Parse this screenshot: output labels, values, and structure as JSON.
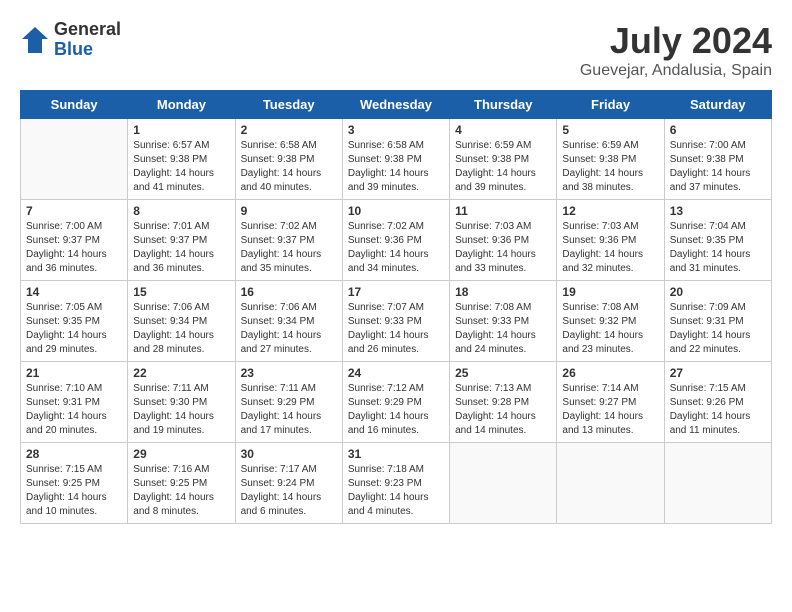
{
  "header": {
    "logo_general": "General",
    "logo_blue": "Blue",
    "month_title": "July 2024",
    "location": "Guevejar, Andalusia, Spain"
  },
  "days_of_week": [
    "Sunday",
    "Monday",
    "Tuesday",
    "Wednesday",
    "Thursday",
    "Friday",
    "Saturday"
  ],
  "weeks": [
    [
      {
        "day": "",
        "info": ""
      },
      {
        "day": "1",
        "info": "Sunrise: 6:57 AM\nSunset: 9:38 PM\nDaylight: 14 hours\nand 41 minutes."
      },
      {
        "day": "2",
        "info": "Sunrise: 6:58 AM\nSunset: 9:38 PM\nDaylight: 14 hours\nand 40 minutes."
      },
      {
        "day": "3",
        "info": "Sunrise: 6:58 AM\nSunset: 9:38 PM\nDaylight: 14 hours\nand 39 minutes."
      },
      {
        "day": "4",
        "info": "Sunrise: 6:59 AM\nSunset: 9:38 PM\nDaylight: 14 hours\nand 39 minutes."
      },
      {
        "day": "5",
        "info": "Sunrise: 6:59 AM\nSunset: 9:38 PM\nDaylight: 14 hours\nand 38 minutes."
      },
      {
        "day": "6",
        "info": "Sunrise: 7:00 AM\nSunset: 9:38 PM\nDaylight: 14 hours\nand 37 minutes."
      }
    ],
    [
      {
        "day": "7",
        "info": "Sunrise: 7:00 AM\nSunset: 9:37 PM\nDaylight: 14 hours\nand 36 minutes."
      },
      {
        "day": "8",
        "info": "Sunrise: 7:01 AM\nSunset: 9:37 PM\nDaylight: 14 hours\nand 36 minutes."
      },
      {
        "day": "9",
        "info": "Sunrise: 7:02 AM\nSunset: 9:37 PM\nDaylight: 14 hours\nand 35 minutes."
      },
      {
        "day": "10",
        "info": "Sunrise: 7:02 AM\nSunset: 9:36 PM\nDaylight: 14 hours\nand 34 minutes."
      },
      {
        "day": "11",
        "info": "Sunrise: 7:03 AM\nSunset: 9:36 PM\nDaylight: 14 hours\nand 33 minutes."
      },
      {
        "day": "12",
        "info": "Sunrise: 7:03 AM\nSunset: 9:36 PM\nDaylight: 14 hours\nand 32 minutes."
      },
      {
        "day": "13",
        "info": "Sunrise: 7:04 AM\nSunset: 9:35 PM\nDaylight: 14 hours\nand 31 minutes."
      }
    ],
    [
      {
        "day": "14",
        "info": "Sunrise: 7:05 AM\nSunset: 9:35 PM\nDaylight: 14 hours\nand 29 minutes."
      },
      {
        "day": "15",
        "info": "Sunrise: 7:06 AM\nSunset: 9:34 PM\nDaylight: 14 hours\nand 28 minutes."
      },
      {
        "day": "16",
        "info": "Sunrise: 7:06 AM\nSunset: 9:34 PM\nDaylight: 14 hours\nand 27 minutes."
      },
      {
        "day": "17",
        "info": "Sunrise: 7:07 AM\nSunset: 9:33 PM\nDaylight: 14 hours\nand 26 minutes."
      },
      {
        "day": "18",
        "info": "Sunrise: 7:08 AM\nSunset: 9:33 PM\nDaylight: 14 hours\nand 24 minutes."
      },
      {
        "day": "19",
        "info": "Sunrise: 7:08 AM\nSunset: 9:32 PM\nDaylight: 14 hours\nand 23 minutes."
      },
      {
        "day": "20",
        "info": "Sunrise: 7:09 AM\nSunset: 9:31 PM\nDaylight: 14 hours\nand 22 minutes."
      }
    ],
    [
      {
        "day": "21",
        "info": "Sunrise: 7:10 AM\nSunset: 9:31 PM\nDaylight: 14 hours\nand 20 minutes."
      },
      {
        "day": "22",
        "info": "Sunrise: 7:11 AM\nSunset: 9:30 PM\nDaylight: 14 hours\nand 19 minutes."
      },
      {
        "day": "23",
        "info": "Sunrise: 7:11 AM\nSunset: 9:29 PM\nDaylight: 14 hours\nand 17 minutes."
      },
      {
        "day": "24",
        "info": "Sunrise: 7:12 AM\nSunset: 9:29 PM\nDaylight: 14 hours\nand 16 minutes."
      },
      {
        "day": "25",
        "info": "Sunrise: 7:13 AM\nSunset: 9:28 PM\nDaylight: 14 hours\nand 14 minutes."
      },
      {
        "day": "26",
        "info": "Sunrise: 7:14 AM\nSunset: 9:27 PM\nDaylight: 14 hours\nand 13 minutes."
      },
      {
        "day": "27",
        "info": "Sunrise: 7:15 AM\nSunset: 9:26 PM\nDaylight: 14 hours\nand 11 minutes."
      }
    ],
    [
      {
        "day": "28",
        "info": "Sunrise: 7:15 AM\nSunset: 9:25 PM\nDaylight: 14 hours\nand 10 minutes."
      },
      {
        "day": "29",
        "info": "Sunrise: 7:16 AM\nSunset: 9:25 PM\nDaylight: 14 hours\nand 8 minutes."
      },
      {
        "day": "30",
        "info": "Sunrise: 7:17 AM\nSunset: 9:24 PM\nDaylight: 14 hours\nand 6 minutes."
      },
      {
        "day": "31",
        "info": "Sunrise: 7:18 AM\nSunset: 9:23 PM\nDaylight: 14 hours\nand 4 minutes."
      },
      {
        "day": "",
        "info": ""
      },
      {
        "day": "",
        "info": ""
      },
      {
        "day": "",
        "info": ""
      }
    ]
  ]
}
